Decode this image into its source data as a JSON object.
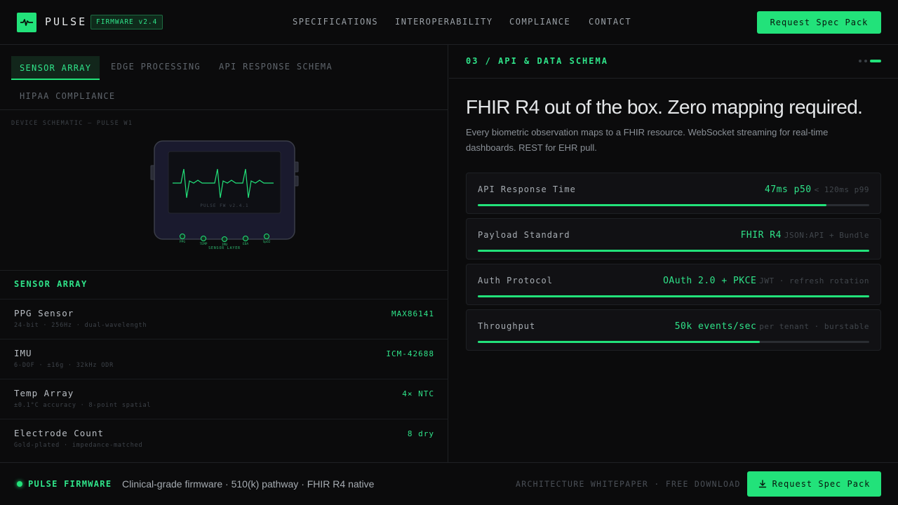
{
  "header": {
    "brand": "PULSE",
    "firmware_badge": "FIRMWARE v2.4",
    "nav": [
      "SPECIFICATIONS",
      "INTEROPERABILITY",
      "COMPLIANCE",
      "CONTACT"
    ],
    "cta_label": "Request Spec Pack"
  },
  "left": {
    "tabs": [
      "SENSOR ARRAY",
      "EDGE PROCESSING",
      "API RESPONSE SCHEMA",
      "HIPAA COMPLIANCE"
    ],
    "active_tab": "SENSOR ARRAY",
    "schematic_label": "DEVICE SCHEMATIC — PULSE W1",
    "device_screen_text": "PULSE FW v2.4.1",
    "sensor_pads": [
      "PPG",
      "TEMP",
      "IMU",
      "EDA",
      "SpO2"
    ],
    "sensor_layer_label": "SENSOR LAYER",
    "section_title": "SENSOR ARRAY",
    "specs": [
      {
        "name": "PPG Sensor",
        "sub": "24-bit · 256Hz · dual-wavelength",
        "value": "MAX86141"
      },
      {
        "name": "IMU",
        "sub": "6-DOF · ±16g · 32kHz ODR",
        "value": "ICM-42688"
      },
      {
        "name": "Temp Array",
        "sub": "±0.1°C accuracy · 8-point spatial",
        "value": "4× NTC"
      },
      {
        "name": "Electrode Count",
        "sub": "Gold-plated · impedance-matched",
        "value": "8 dry"
      }
    ]
  },
  "right": {
    "kicker": "03 / API & DATA SCHEMA",
    "headline": "FHIR R4 out of the box. Zero mapping required.",
    "lede": "Every biometric observation maps to a FHIR resource. WebSocket streaming for real-time dashboards. REST for EHR pull.",
    "metrics": [
      {
        "label": "API Response Time",
        "value": "47ms p50",
        "note": "< 120ms p99",
        "fill": 0.89
      },
      {
        "label": "Payload Standard",
        "value": "FHIR R4",
        "note": "JSON:API + Bundle",
        "fill": 1.0
      },
      {
        "label": "Auth Protocol",
        "value": "OAuth 2.0 + PKCE",
        "note": "JWT · refresh rotation",
        "fill": 1.0
      },
      {
        "label": "Throughput",
        "value": "50k events/sec",
        "note": "per tenant · burstable",
        "fill": 0.72
      }
    ]
  },
  "footer": {
    "brand": "PULSE FIRMWARE",
    "tagline": "Clinical-grade firmware · 510(k) pathway · FHIR R4 native",
    "link": "ARCHITECTURE WHITEPAPER · FREE DOWNLOAD",
    "cta_label": "Request Spec Pack"
  },
  "colors": {
    "accent": "#22e27a",
    "background": "#0b0b0c",
    "panel": "#111114"
  },
  "icons": {
    "logo": "pulse-wave-icon",
    "download": "download-icon"
  }
}
